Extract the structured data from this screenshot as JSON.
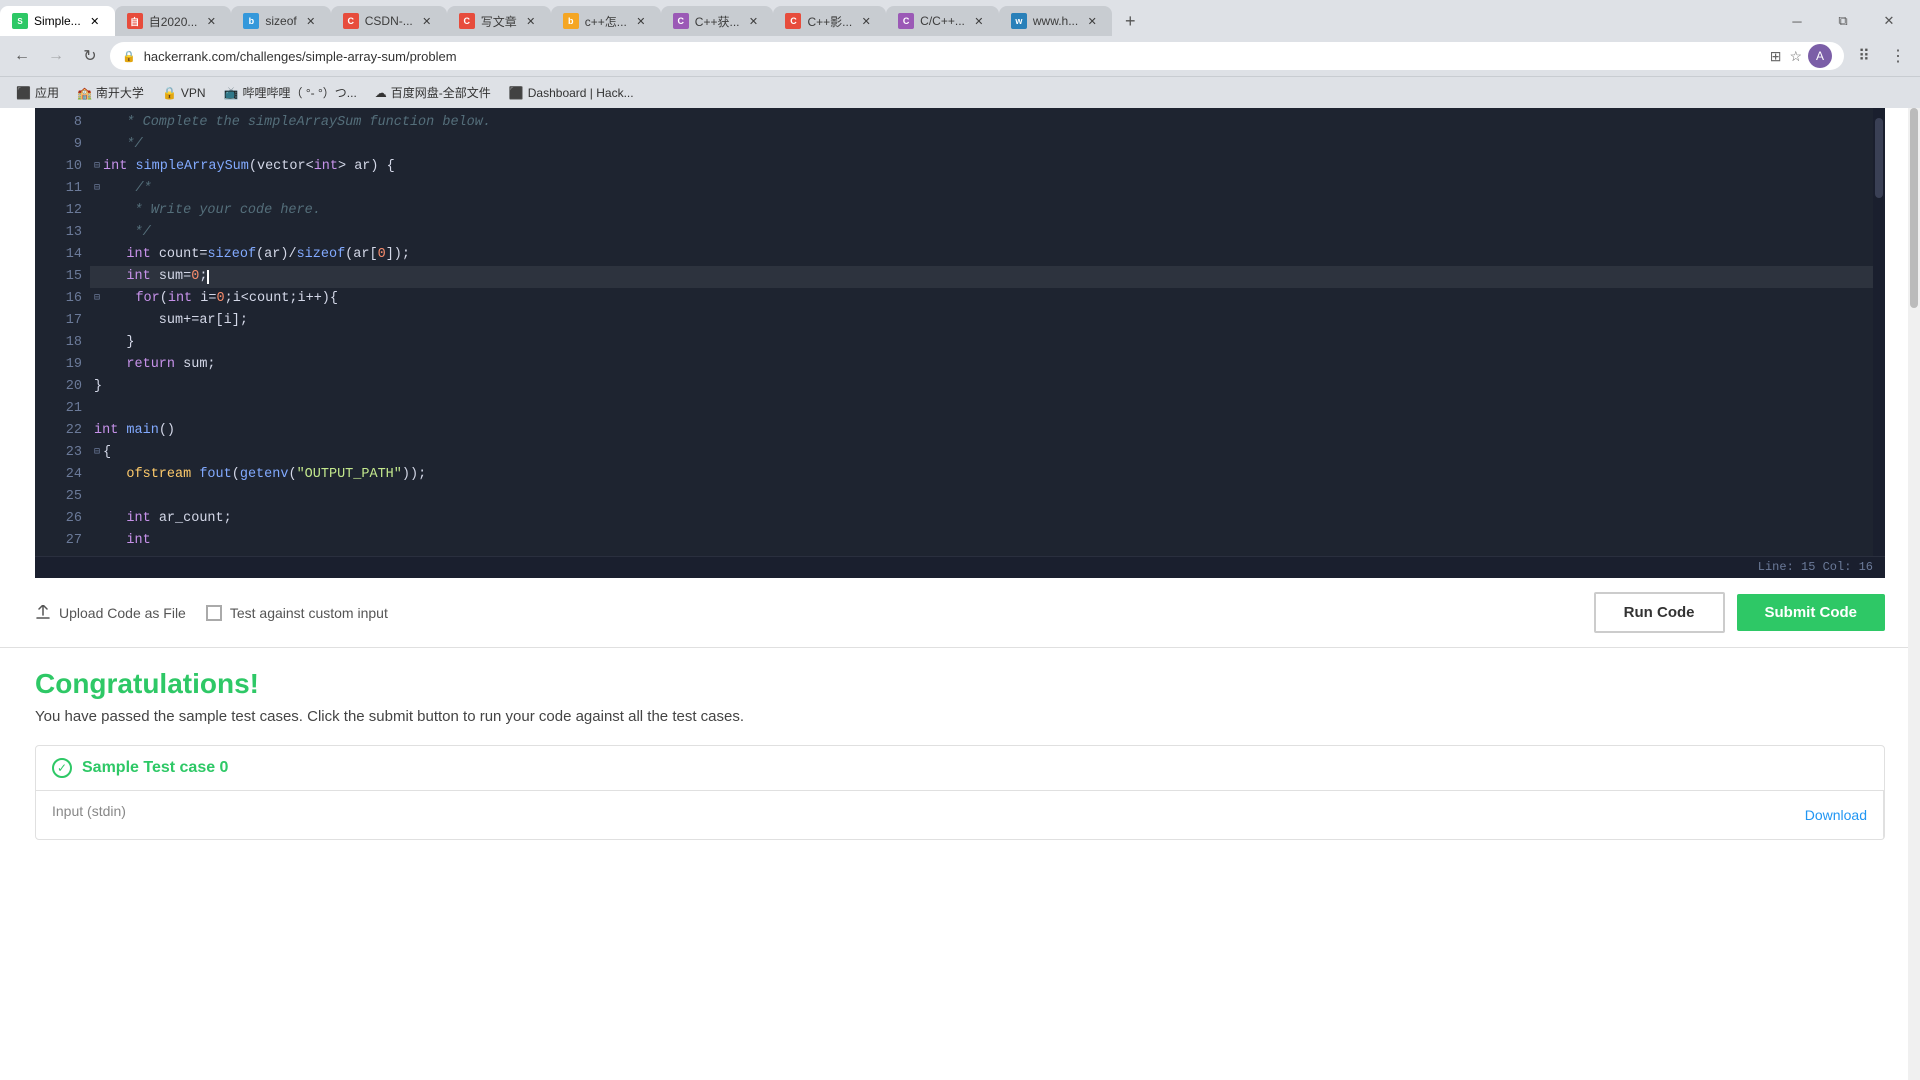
{
  "browser": {
    "tabs": [
      {
        "id": "tab1",
        "favicon_color": "#2ec866",
        "favicon_text": "S",
        "label": "Simple...",
        "active": true
      },
      {
        "id": "tab2",
        "favicon_color": "#e74c3c",
        "favicon_text": "自",
        "label": "自2020...",
        "active": false
      },
      {
        "id": "tab3",
        "favicon_color": "#3498db",
        "favicon_text": "b",
        "label": "sizeof",
        "active": false
      },
      {
        "id": "tab4",
        "favicon_color": "#e74c3c",
        "favicon_text": "C",
        "label": "CSDN-...",
        "active": false
      },
      {
        "id": "tab5",
        "favicon_color": "#e74c3c",
        "favicon_text": "C",
        "label": "写文章",
        "active": false
      },
      {
        "id": "tab6",
        "favicon_color": "#f5a623",
        "favicon_text": "b",
        "label": "c++怎...",
        "active": false
      },
      {
        "id": "tab7",
        "favicon_color": "#9b59b6",
        "favicon_text": "C",
        "label": "C++获...",
        "active": false
      },
      {
        "id": "tab8",
        "favicon_color": "#e74c3c",
        "favicon_text": "C",
        "label": "C++影...",
        "active": false
      },
      {
        "id": "tab9",
        "favicon_color": "#9b59b6",
        "favicon_text": "C",
        "label": "C/C++...",
        "active": false
      },
      {
        "id": "tab10",
        "favicon_color": "#2980b9",
        "favicon_text": "w",
        "label": "www.h...",
        "active": false
      }
    ],
    "url": "hackerrank.com/challenges/simple-array-sum/problem",
    "bookmarks": [
      {
        "label": "应用",
        "favicon": "⬛"
      },
      {
        "label": "南开大学",
        "favicon": "🏫"
      },
      {
        "label": "VPN",
        "favicon": "🔒"
      },
      {
        "label": "哔哩哔哩（ °- °）つ...",
        "favicon": "📺"
      },
      {
        "label": "百度网盘-全部文件",
        "favicon": "☁"
      },
      {
        "label": "Dashboard | Hack...",
        "favicon": "⬛"
      }
    ]
  },
  "editor": {
    "lines": [
      {
        "num": "8",
        "content": "    * Complete the simpleArraySum function below.",
        "type": "comment"
      },
      {
        "num": "9",
        "content": "    */",
        "type": "comment"
      },
      {
        "num": "10",
        "content": "int simpleArraySum(vector<int> ar) {",
        "type": "code",
        "fold": true
      },
      {
        "num": "11",
        "content": "    /*",
        "type": "comment",
        "fold": true
      },
      {
        "num": "12",
        "content": "     * Write your code here.",
        "type": "comment"
      },
      {
        "num": "13",
        "content": "     */",
        "type": "comment"
      },
      {
        "num": "14",
        "content": "    int count=sizeof(ar)/sizeof(ar[0]);",
        "type": "code"
      },
      {
        "num": "15",
        "content": "    int sum=0;",
        "type": "code",
        "cursor": true
      },
      {
        "num": "16",
        "content": "    for(int i=0;i<count;i++){",
        "type": "code",
        "fold": true
      },
      {
        "num": "17",
        "content": "        sum+=ar[i];",
        "type": "code"
      },
      {
        "num": "18",
        "content": "    }",
        "type": "code"
      },
      {
        "num": "19",
        "content": "    return sum;",
        "type": "code"
      },
      {
        "num": "20",
        "content": "}",
        "type": "code"
      },
      {
        "num": "21",
        "content": "",
        "type": "empty"
      },
      {
        "num": "22",
        "content": "int main()",
        "type": "code"
      },
      {
        "num": "23",
        "content": "{",
        "type": "code",
        "fold": true
      },
      {
        "num": "24",
        "content": "    ofstream fout(getenv(\"OUTPUT_PATH\"));",
        "type": "code"
      },
      {
        "num": "25",
        "content": "",
        "type": "empty"
      },
      {
        "num": "26",
        "content": "    int ar_count;",
        "type": "code"
      },
      {
        "num": "27",
        "content": "",
        "type": "partial"
      }
    ],
    "status": {
      "line": "15",
      "col": "16",
      "label": "Line: 15 Col: 16"
    }
  },
  "toolbar": {
    "upload_label": "Upload Code as File",
    "test_label": "Test against custom input",
    "run_label": "Run Code",
    "submit_label": "Submit Code"
  },
  "results": {
    "title": "Congratulations!",
    "description": "You have passed the sample test cases. Click the submit button to run your code against all the test cases.",
    "test_case": {
      "title": "Sample Test case 0",
      "input_label": "Input (stdin)",
      "download_label": "Download"
    }
  }
}
